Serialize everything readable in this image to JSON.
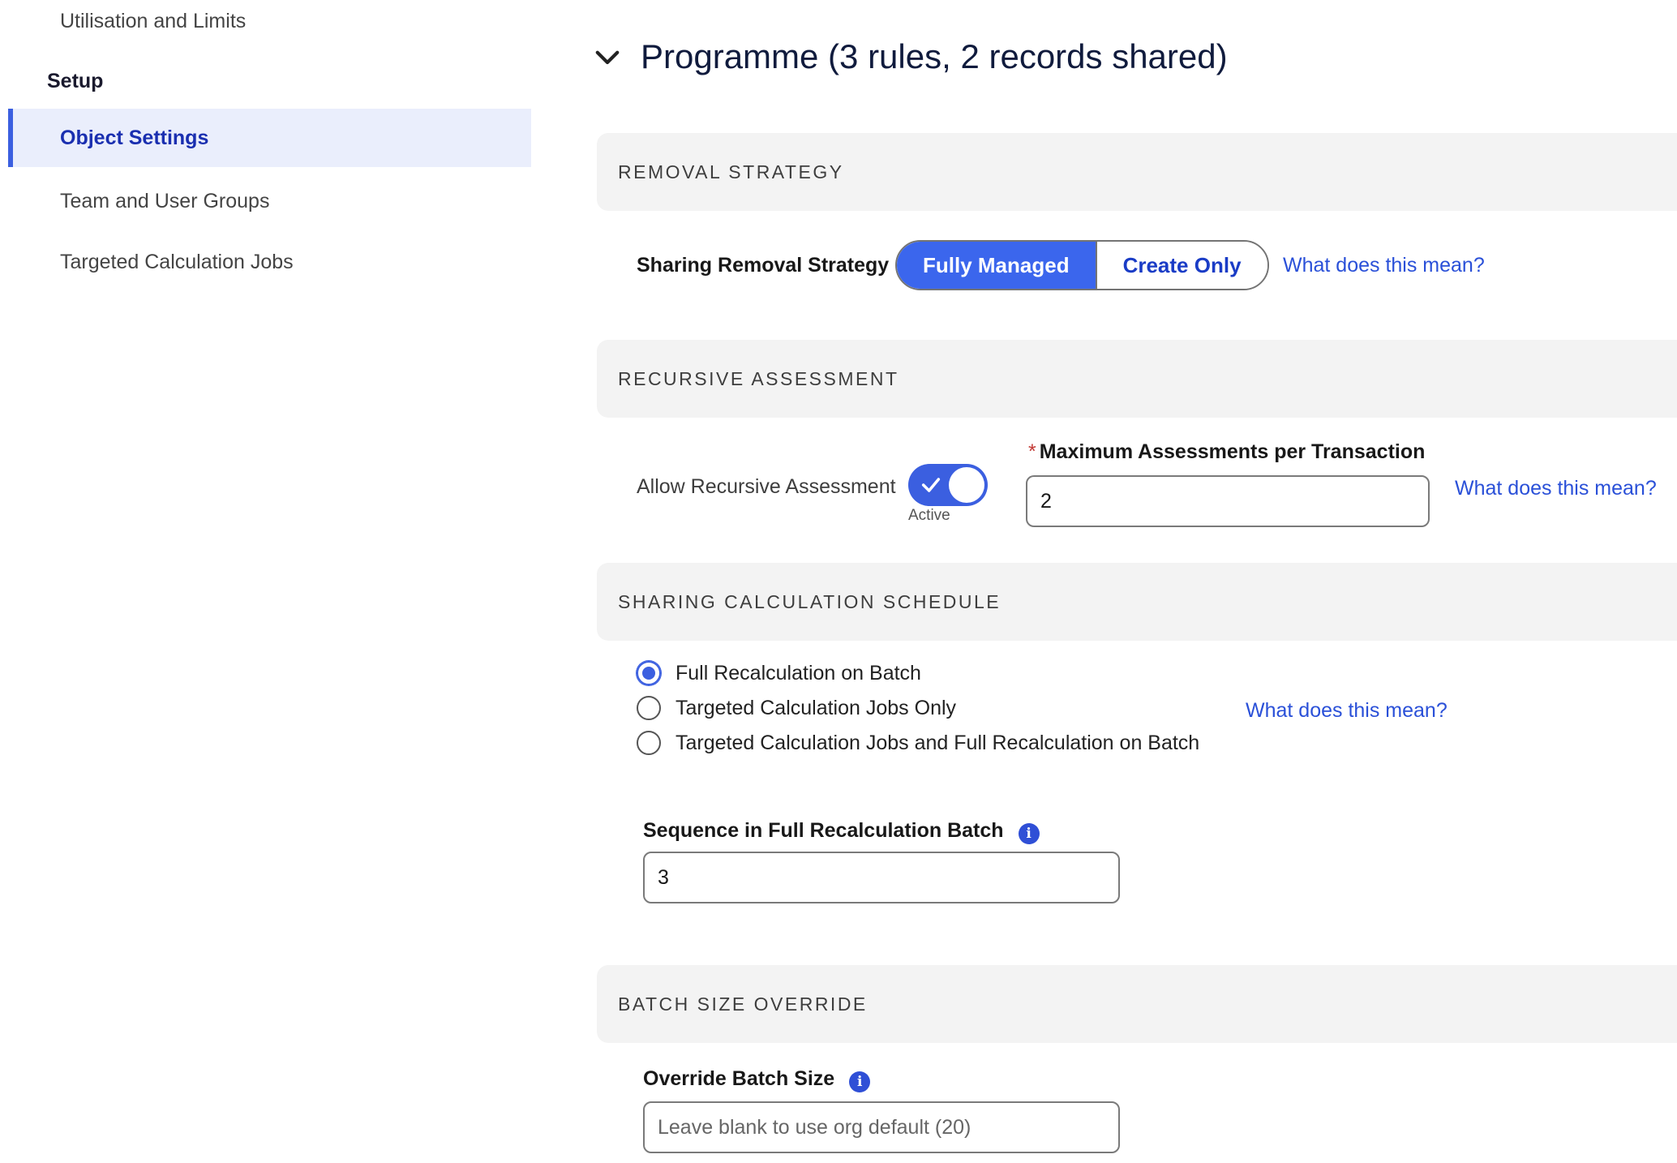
{
  "sidebar": {
    "items_top": [
      {
        "label": "Utilisation and Limits"
      }
    ],
    "setup_heading": "Setup",
    "items": [
      {
        "label": "Object Settings",
        "active": true
      },
      {
        "label": "Team and User Groups"
      },
      {
        "label": "Targeted Calculation Jobs"
      }
    ]
  },
  "header": {
    "title": "Programme (3 rules, 2 records shared)",
    "chevron_icon": "chevron-down-icon"
  },
  "removal": {
    "heading": "REMOVAL STRATEGY",
    "label": "Sharing Removal Strategy",
    "options": [
      "Fully Managed",
      "Create Only"
    ],
    "selected": "Fully Managed",
    "help_link": "What does this mean?"
  },
  "recursive": {
    "heading": "RECURSIVE ASSESSMENT",
    "toggle_label": "Allow Recursive Assessment",
    "toggle_state": "Active",
    "max_label": "Maximum Assessments per Transaction",
    "required_marker": "*",
    "max_value": "2",
    "help_link": "What does this mean?"
  },
  "schedule": {
    "heading": "SHARING CALCULATION SCHEDULE",
    "options": [
      {
        "label": "Full Recalculation on Batch",
        "checked": true
      },
      {
        "label": "Targeted Calculation Jobs Only",
        "checked": false
      },
      {
        "label": "Targeted Calculation Jobs and Full Recalculation on Batch",
        "checked": false
      }
    ],
    "help_link": "What does this mean?",
    "sequence_label": "Sequence in Full Recalculation Batch",
    "sequence_value": "3",
    "info_icon": "i"
  },
  "batch": {
    "heading": "BATCH SIZE OVERRIDE",
    "override_label": "Override Batch Size",
    "override_placeholder": "Leave blank to use org default (20)",
    "info_icon": "i"
  },
  "colors": {
    "accent": "#3b5fe0",
    "link": "#2a50d8",
    "section_bg": "#f3f3f3",
    "active_nav_bg": "#eaeefc"
  }
}
